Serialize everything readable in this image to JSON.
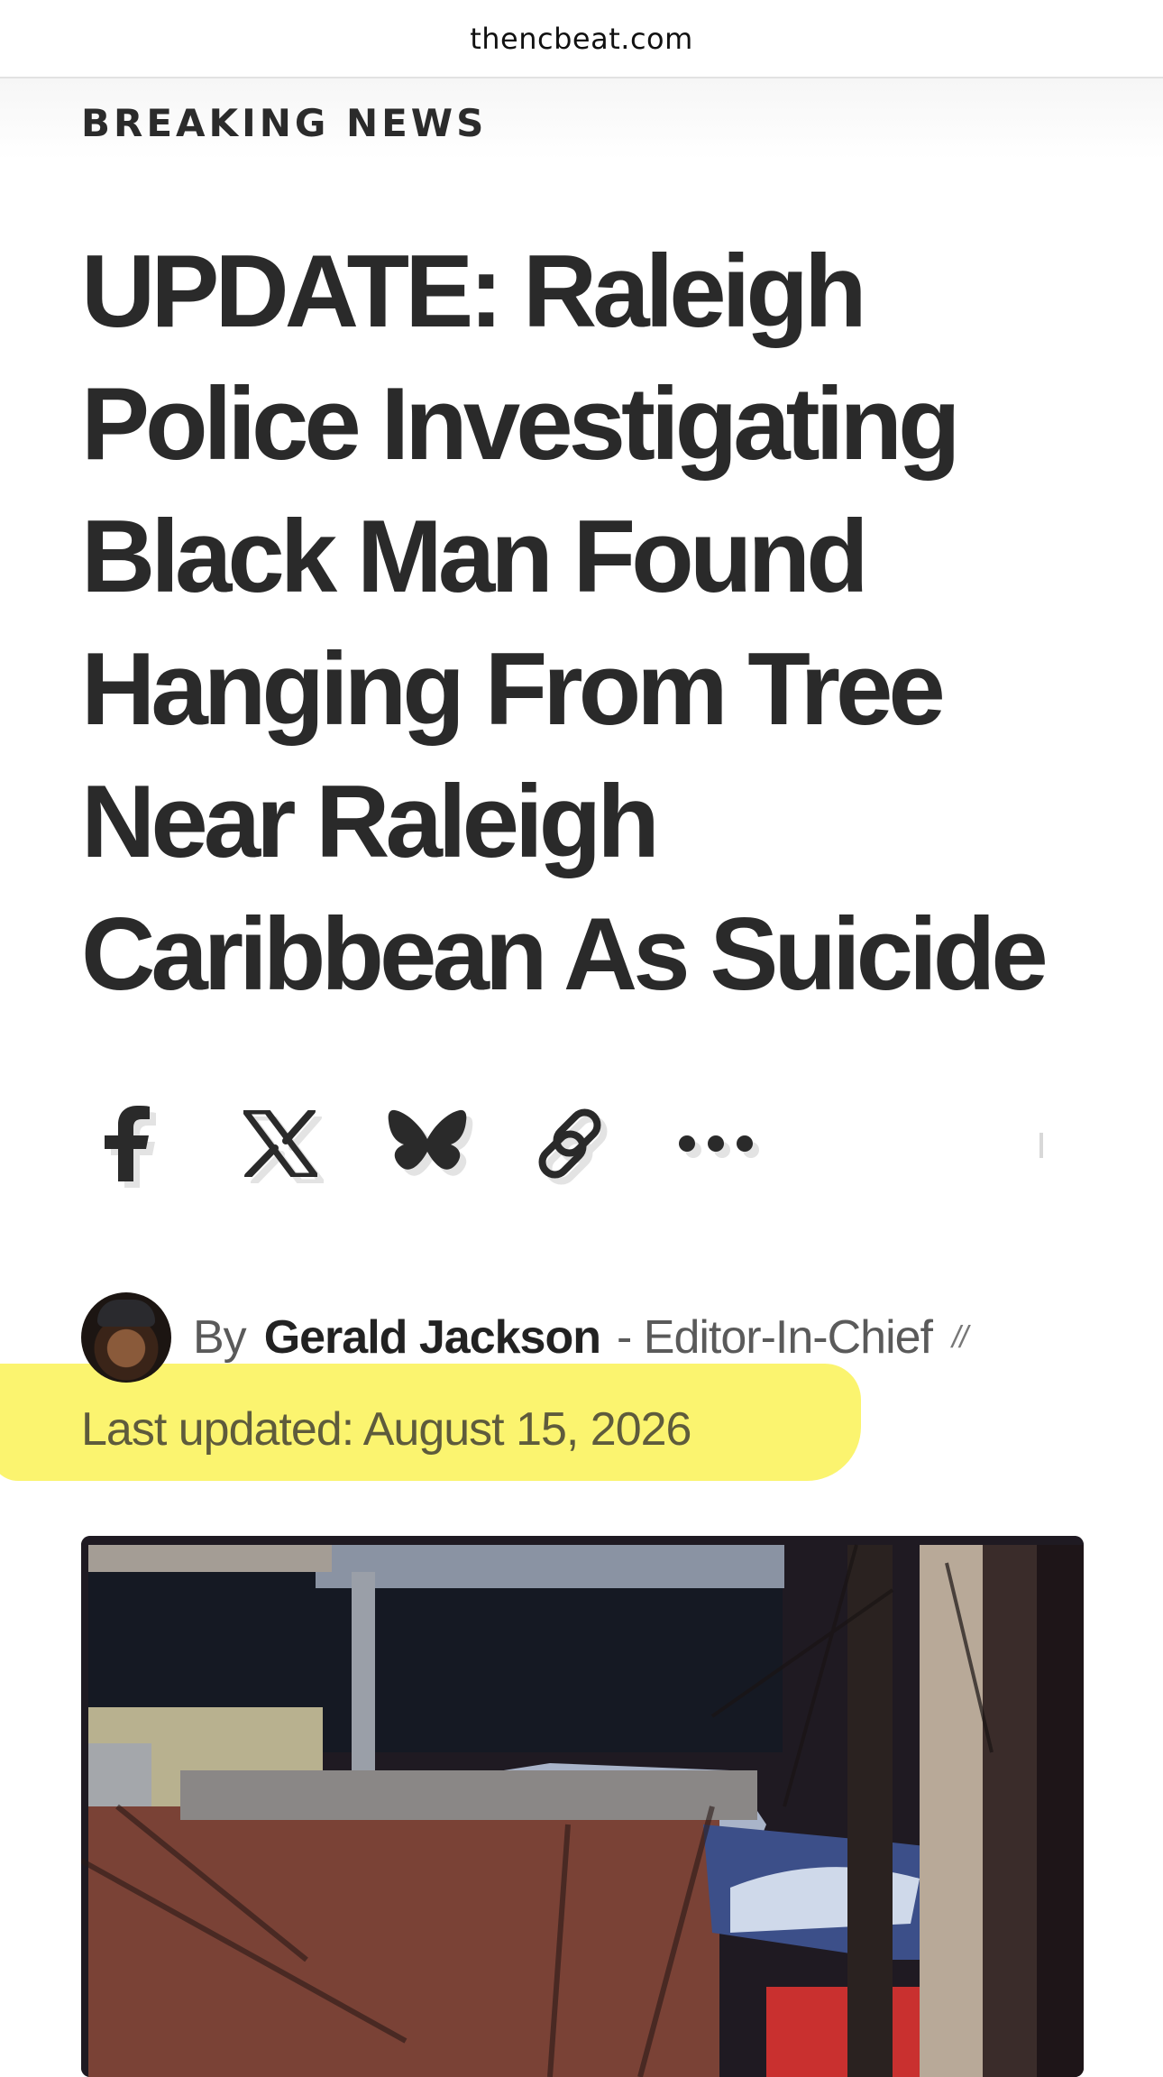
{
  "browser": {
    "domain": "thencbeat.com"
  },
  "article": {
    "kicker": "BREAKING NEWS",
    "headline": "UPDATE: Raleigh Police Investigating Black Man Found Hanging From Tree Near Raleigh Caribbean As Suicide"
  },
  "share": {
    "icons": [
      "facebook-icon",
      "x-icon",
      "bluesky-icon",
      "link-icon",
      "more-icon"
    ]
  },
  "byline": {
    "prefix": "By",
    "author": "Gerald Jackson",
    "role": "- Editor-In-Chief",
    "separator": "//"
  },
  "updated": {
    "text": "Last updated: August 15, 2026"
  },
  "colors": {
    "highlight": "#fbf46f",
    "text": "#2a2a2a"
  }
}
